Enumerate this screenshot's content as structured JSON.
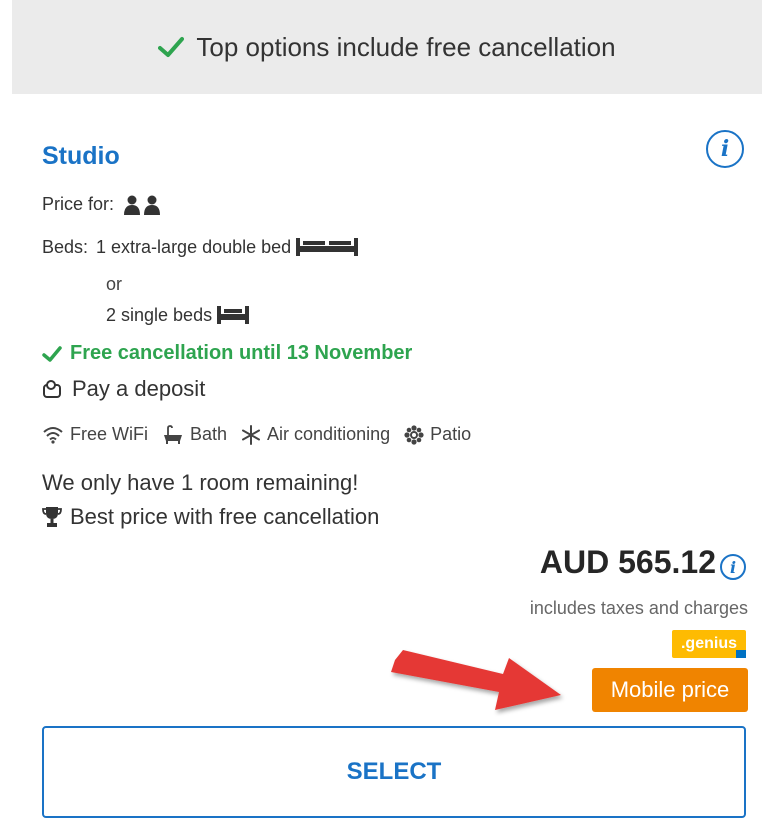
{
  "banner": {
    "text": "Top options include free cancellation"
  },
  "room": {
    "title": "Studio",
    "price_for_label": "Price for:",
    "beds_label": "Beds:",
    "bed_option_1": "1 extra-large double bed",
    "or_text": "or",
    "bed_option_2": "2 single beds",
    "free_cancellation": "Free cancellation until 13 November",
    "deposit": "Pay a deposit",
    "amenities": [
      "Free WiFi",
      "Bath",
      "Air conditioning",
      "Patio"
    ],
    "remaining": "We only have 1 room remaining!",
    "best_price": "Best price with free cancellation"
  },
  "pricing": {
    "price": "AUD 565.12",
    "taxes_note": "includes taxes and charges",
    "genius_badge": ".genius",
    "mobile_price_badge": "Mobile price"
  },
  "actions": {
    "select_label": "SELECT"
  },
  "colors": {
    "accent_blue": "#1a73c6",
    "green": "#2ea44f",
    "genius_yellow": "#febb02",
    "mobile_orange": "#f08400",
    "annotation_arrow": "#e53935"
  },
  "icons": [
    "checkmark-icon",
    "info-icon",
    "person-icon",
    "double-bed-icon",
    "single-bed-icon",
    "deposit-icon",
    "wifi-icon",
    "bath-icon",
    "snowflake-icon",
    "patio-icon",
    "trophy-icon",
    "arrow-annotation"
  ]
}
